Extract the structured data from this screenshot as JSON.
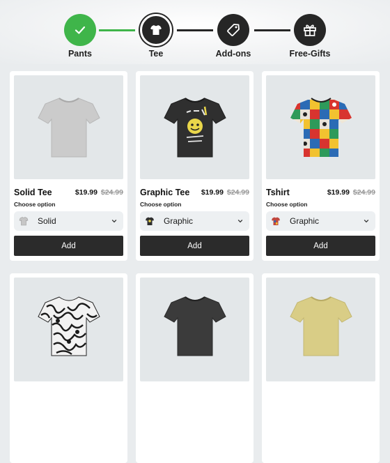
{
  "stepper": {
    "steps": [
      {
        "label": "Pants",
        "icon": "check-icon",
        "state": "complete"
      },
      {
        "label": "Tee",
        "icon": "tshirt-icon",
        "state": "current"
      },
      {
        "label": "Add-ons",
        "icon": "tag-icon",
        "state": "upcoming"
      },
      {
        "label": "Free-Gifts",
        "icon": "gift-icon",
        "state": "upcoming"
      }
    ],
    "colors": {
      "complete": "#3fb54a",
      "dark": "#262626"
    }
  },
  "products": [
    {
      "name": "Solid Tee",
      "price": "$19.99",
      "compare_price": "$24.99",
      "choose_label": "Choose option",
      "option": "Solid",
      "add_label": "Add",
      "shirt_color": "#c9c9c9",
      "pattern": "solid"
    },
    {
      "name": "Graphic Tee",
      "price": "$19.99",
      "compare_price": "$24.99",
      "choose_label": "Choose option",
      "option": "Graphic",
      "add_label": "Add",
      "shirt_color": "#2f2f2f",
      "pattern": "graphic"
    },
    {
      "name": "Tshirt",
      "price": "$19.99",
      "compare_price": "$24.99",
      "choose_label": "Choose option",
      "option": "Graphic",
      "add_label": "Add",
      "shirt_color": "#e8e2d8",
      "pattern": "colorful"
    },
    {
      "shirt_color": "#f2f2f2",
      "pattern": "doodle"
    },
    {
      "shirt_color": "#3b3b3b",
      "pattern": "solid"
    },
    {
      "shirt_color": "#d9cd86",
      "pattern": "solid"
    }
  ]
}
